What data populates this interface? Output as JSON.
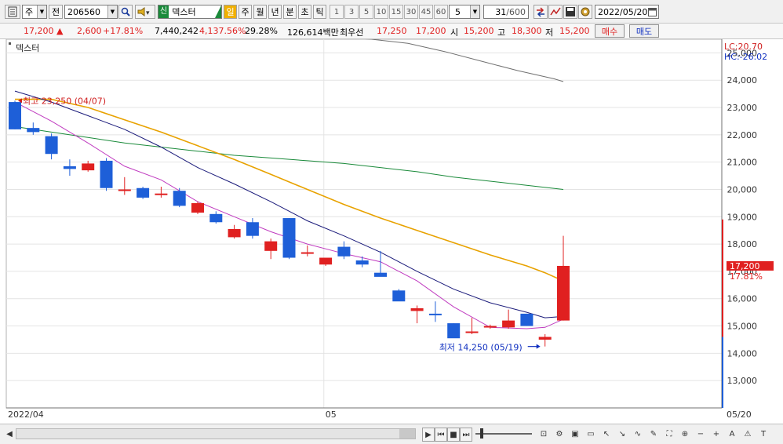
{
  "toolbar": {
    "market_select": "주",
    "prev_label": "전",
    "code": "206560",
    "badge_new": "신",
    "stock_name": "덱스터",
    "periods": [
      "일",
      "주",
      "월",
      "년",
      "분",
      "초",
      "틱"
    ],
    "active_period": "일",
    "intervals": [
      "1",
      "3",
      "5",
      "10",
      "15",
      "30",
      "45",
      "60"
    ],
    "interval_value": "5",
    "count_current": "31",
    "count_total": "/600",
    "date": "2022/05/20"
  },
  "quote": {
    "price": "17,200",
    "change_arrow": "▲",
    "change": "2,600",
    "change_pct": "+17.81%",
    "volume": "7,440,242",
    "volume_ratio": "4,137.56%",
    "turnover": "29.28%",
    "amount": "126,614백만",
    "best_label": "최우선",
    "best_ask": "17,250",
    "best_bid": "17,200",
    "open_label": "시",
    "open": "15,200",
    "high_label": "고",
    "high": "18,300",
    "low_label": "저",
    "low": "15,200",
    "buy_label": "매수",
    "sell_label": "매도"
  },
  "chart": {
    "legend": "덱스터",
    "lc_label": "LC:20.70",
    "hc_label": "HC:-26.02",
    "max_annotation": "최고 23,250 (04/07)",
    "min_annotation": "최저 14,250 (05/19)",
    "current_price_label": "17,200",
    "current_change_label": "17.81%",
    "x_labels": [
      "2022/04",
      "05",
      "05/20"
    ],
    "colors": {
      "up": "#e02020",
      "down": "#1e5fd8",
      "ma5": "#c03cc0",
      "ma10": "#1a1a7a",
      "ma20": "#e8a200",
      "ma60": "#1a8a3a",
      "ma120": "#707070"
    }
  },
  "chart_data": {
    "type": "candlestick",
    "ylim": [
      12000,
      25500
    ],
    "yticks": [
      "25,000",
      "24,000",
      "23,000",
      "22,000",
      "21,000",
      "20,000",
      "19,000",
      "18,000",
      "17,000",
      "16,000",
      "15,000",
      "14,000",
      "13,000"
    ],
    "ytick_values": [
      25000,
      24000,
      23000,
      22000,
      21000,
      20000,
      19000,
      18000,
      17000,
      16000,
      15000,
      14000,
      13000
    ],
    "candles": [
      {
        "o": 23200,
        "h": 23250,
        "l": 22200,
        "c": 22200
      },
      {
        "o": 22250,
        "h": 22450,
        "l": 22000,
        "c": 22100
      },
      {
        "o": 21950,
        "h": 22050,
        "l": 21100,
        "c": 21300
      },
      {
        "o": 20850,
        "h": 21100,
        "l": 20500,
        "c": 20750
      },
      {
        "o": 20700,
        "h": 21050,
        "l": 20650,
        "c": 20950
      },
      {
        "o": 21050,
        "h": 21150,
        "l": 19950,
        "c": 20050
      },
      {
        "o": 19950,
        "h": 20450,
        "l": 19800,
        "c": 20000
      },
      {
        "o": 20050,
        "h": 20100,
        "l": 19650,
        "c": 19700
      },
      {
        "o": 19850,
        "h": 20100,
        "l": 19700,
        "c": 19850
      },
      {
        "o": 19950,
        "h": 20050,
        "l": 19350,
        "c": 19400
      },
      {
        "o": 19150,
        "h": 19550,
        "l": 19100,
        "c": 19500
      },
      {
        "o": 19100,
        "h": 19200,
        "l": 18750,
        "c": 18800
      },
      {
        "o": 18250,
        "h": 18700,
        "l": 18200,
        "c": 18550
      },
      {
        "o": 18800,
        "h": 18950,
        "l": 18200,
        "c": 18300
      },
      {
        "o": 17750,
        "h": 18200,
        "l": 17450,
        "c": 18100
      },
      {
        "o": 18950,
        "h": 18950,
        "l": 17450,
        "c": 17500
      },
      {
        "o": 17650,
        "h": 17950,
        "l": 17550,
        "c": 17700
      },
      {
        "o": 17250,
        "h": 17450,
        "l": 17200,
        "c": 17500
      },
      {
        "o": 17900,
        "h": 18100,
        "l": 17450,
        "c": 17550
      },
      {
        "o": 17400,
        "h": 17550,
        "l": 17150,
        "c": 17250
      },
      {
        "o": 16950,
        "h": 17750,
        "l": 16850,
        "c": 16800
      },
      {
        "o": 16300,
        "h": 16350,
        "l": 15950,
        "c": 15900
      },
      {
        "o": 15550,
        "h": 15750,
        "l": 15100,
        "c": 15650
      },
      {
        "o": 15450,
        "h": 15900,
        "l": 15150,
        "c": 15400
      },
      {
        "o": 15100,
        "h": 15100,
        "l": 14600,
        "c": 14550
      },
      {
        "o": 14750,
        "h": 15300,
        "l": 14700,
        "c": 14800
      },
      {
        "o": 14950,
        "h": 15050,
        "l": 14900,
        "c": 15000
      },
      {
        "o": 14950,
        "h": 15600,
        "l": 14900,
        "c": 15200
      },
      {
        "o": 15450,
        "h": 15450,
        "l": 15000,
        "c": 15000
      },
      {
        "o": 14500,
        "h": 14700,
        "l": 14250,
        "c": 14600
      },
      {
        "o": 15200,
        "h": 18300,
        "l": 15200,
        "c": 17200
      }
    ],
    "ma": [
      {
        "name": "ma120",
        "values": [
          null,
          null,
          null,
          null,
          null,
          null,
          null,
          null,
          null,
          null,
          null,
          null,
          null,
          null,
          null,
          null,
          null,
          null,
          null,
          null,
          null,
          null,
          null,
          null,
          null,
          null,
          null,
          null,
          null,
          null,
          null
        ],
        "points": [
          [
            15.6,
            25650
          ],
          [
            17.5,
            25580
          ],
          [
            19.5,
            25500
          ],
          [
            21.5,
            25350
          ],
          [
            23.5,
            25050
          ],
          [
            25.5,
            24700
          ],
          [
            27.5,
            24350
          ],
          [
            29.5,
            24050
          ],
          [
            30.0,
            23950
          ]
        ]
      },
      {
        "name": "ma60",
        "points": [
          [
            0,
            22300
          ],
          [
            2,
            22100
          ],
          [
            4,
            21900
          ],
          [
            6,
            21700
          ],
          [
            8,
            21550
          ],
          [
            10,
            21400
          ],
          [
            12,
            21250
          ],
          [
            14,
            21150
          ],
          [
            16,
            21050
          ],
          [
            18,
            20950
          ],
          [
            20,
            20800
          ],
          [
            22,
            20650
          ],
          [
            24,
            20450
          ],
          [
            26,
            20300
          ],
          [
            28,
            20150
          ],
          [
            30,
            20000
          ]
        ]
      },
      {
        "name": "ma20",
        "points": [
          [
            0,
            23300
          ],
          [
            2,
            23300
          ],
          [
            4,
            23000
          ],
          [
            6,
            22550
          ],
          [
            8,
            22100
          ],
          [
            10,
            21600
          ],
          [
            12,
            21100
          ],
          [
            14,
            20550
          ],
          [
            16,
            20000
          ],
          [
            18,
            19450
          ],
          [
            20,
            18950
          ],
          [
            22,
            18500
          ],
          [
            24,
            18050
          ],
          [
            26,
            17600
          ],
          [
            28,
            17200
          ],
          [
            29,
            16950
          ],
          [
            30,
            16650
          ]
        ]
      },
      {
        "name": "ma10",
        "points": [
          [
            0,
            23600
          ],
          [
            2,
            23200
          ],
          [
            4,
            22700
          ],
          [
            6,
            22200
          ],
          [
            8,
            21550
          ],
          [
            10,
            20800
          ],
          [
            12,
            20200
          ],
          [
            14,
            19550
          ],
          [
            16,
            18850
          ],
          [
            18,
            18300
          ],
          [
            20,
            17700
          ],
          [
            22,
            17000
          ],
          [
            24,
            16350
          ],
          [
            26,
            15850
          ],
          [
            28,
            15500
          ],
          [
            29,
            15300
          ],
          [
            30,
            15350
          ]
        ]
      },
      {
        "name": "ma5",
        "points": [
          [
            0,
            23200
          ],
          [
            2,
            22500
          ],
          [
            4,
            21700
          ],
          [
            6,
            20850
          ],
          [
            8,
            20350
          ],
          [
            10,
            19550
          ],
          [
            12,
            19000
          ],
          [
            14,
            18450
          ],
          [
            16,
            18000
          ],
          [
            18,
            17650
          ],
          [
            20,
            17350
          ],
          [
            22,
            16650
          ],
          [
            24,
            15700
          ],
          [
            26,
            14950
          ],
          [
            28,
            14900
          ],
          [
            29,
            14950
          ],
          [
            30,
            15250
          ]
        ]
      }
    ]
  },
  "status": {
    "icons": [
      "play-icon",
      "step-back-icon",
      "stop-icon",
      "step-forward-icon"
    ]
  }
}
